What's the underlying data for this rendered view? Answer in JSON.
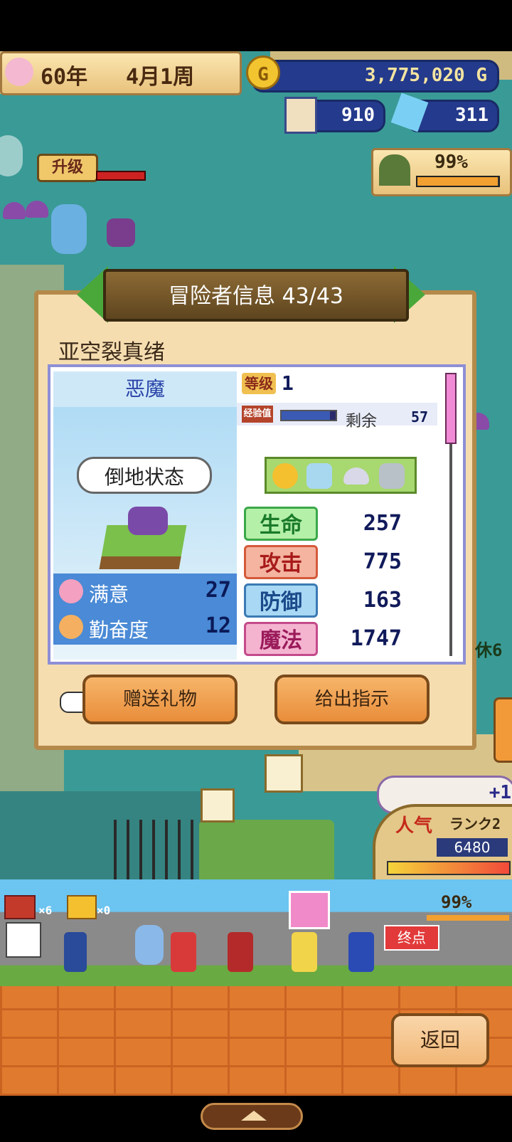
{
  "hud": {
    "year": "60年",
    "week": "4月1周",
    "gold": "3,775,020 G",
    "gold_icon": "G",
    "houses": "910",
    "gems": "311",
    "dungeon_percent": "99%"
  },
  "map": {
    "level_up": "升级",
    "fruit_icon": "peach",
    "banana_icon": "banana"
  },
  "dialog": {
    "title": "冒险者信息 43/43",
    "name": "亚空裂真绪",
    "class": "恶魔",
    "status": "倒地状态",
    "level_label": "等级",
    "level": "1",
    "exp_label": "经验值",
    "exp_fill": 0.9,
    "remain_label": "剩余",
    "remain": "57",
    "satisfaction_label": "满意",
    "satisfaction": "27",
    "diligence_label": "勤奋度",
    "diligence": "12",
    "stats": [
      {
        "label": "生命",
        "value": "257"
      },
      {
        "label": "攻击",
        "value": "775"
      },
      {
        "label": "防御",
        "value": "163"
      },
      {
        "label": "魔法",
        "value": "1747"
      }
    ],
    "gift_button": "赠送礼物",
    "instruct_button": "给出指示"
  },
  "side": {
    "rest": "休6",
    "popularity_label": "人气",
    "popularity_rank": "ランク2",
    "popularity_value": "6480",
    "bonus": "+1"
  },
  "bottom": {
    "chest_count": "×6",
    "key_count": "×0",
    "percent": "99%",
    "spot_label": "终点",
    "back_button": "返回"
  },
  "colors": {
    "map": "#3a9a96",
    "dialog_bg": "#f5ddb0",
    "accent_orange": "#e88d3a",
    "hud_blue": "#243a8c"
  }
}
